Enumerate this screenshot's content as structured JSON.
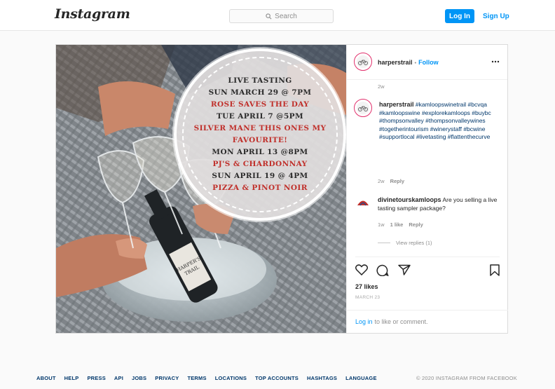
{
  "header": {
    "logo": "Instagram",
    "search_placeholder": "Search",
    "login_label": "Log In",
    "signup_label": "Sign Up"
  },
  "post": {
    "image_text": [
      {
        "text": "LIVE TASTING",
        "color": "#2b2b2b"
      },
      {
        "text": "SUN MARCH 29 @ 7PM",
        "color": "#2b2b2b"
      },
      {
        "text": "ROSE SAVES THE DAY",
        "color": "#c0302b"
      },
      {
        "text": "TUE APRIL 7 @5PM",
        "color": "#2b2b2b"
      },
      {
        "text": "SILVER MANE THIS ONES MY",
        "color": "#c0302b"
      },
      {
        "text": "FAVOURITE!",
        "color": "#c0302b"
      },
      {
        "text": "MON APRIL 13 @8PM",
        "color": "#2b2b2b"
      },
      {
        "text": "PJ'S & CHARDONNAY",
        "color": "#c0302b"
      },
      {
        "text": "SUN APRIL 19 @ 4PM",
        "color": "#2b2b2b"
      },
      {
        "text": "PIZZA & PINOT NOIR",
        "color": "#c0302b"
      }
    ],
    "author": "harperstrail",
    "dot": "•",
    "follow_label": "Follow",
    "more_icon": "more-horizontal-icon",
    "time_ago": "2w",
    "caption": {
      "author": "harperstrail",
      "hashtags": "#kamloopswinetrail #bcvqa #kamloopswine #explorekamloops #buybc #thompsonvalley #thompsonvalleywines #togetherintourism #winerystaff #bcwine #supportlocal #livetasting #flattenthecurve",
      "time": "2w",
      "reply_label": "Reply"
    },
    "comment": {
      "author": "divinetourskamloops",
      "text": "Are you selling a live tasting sampler package?",
      "time": "1w",
      "likes": "1 like",
      "reply_label": "Reply",
      "view_replies": "View replies (1)"
    },
    "likes": "27 likes",
    "date": "MARCH 23",
    "comment_prompt_link": "Log in",
    "comment_prompt_rest": "to like or comment."
  },
  "footer": {
    "links": [
      "ABOUT",
      "HELP",
      "PRESS",
      "API",
      "JOBS",
      "PRIVACY",
      "TERMS",
      "LOCATIONS",
      "TOP ACCOUNTS",
      "HASHTAGS",
      "LANGUAGE"
    ],
    "copyright": "© 2020 INSTAGRAM FROM FACEBOOK"
  },
  "colors": {
    "accent": "#0095f6",
    "avatar_ring": "#e1306c",
    "red_text": "#c0302b"
  }
}
